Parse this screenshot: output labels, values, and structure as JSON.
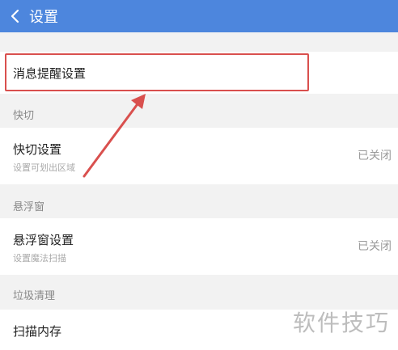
{
  "header": {
    "title": "设置",
    "back_icon": "chevron-left-icon"
  },
  "notification": {
    "label": "消息提醒设置"
  },
  "sections": {
    "quick_cut": "快切",
    "float_window": "悬浮窗",
    "junk_clean": "垃圾清理"
  },
  "quick_cut_setting": {
    "label": "快切设置",
    "sub": "设置可划出区域",
    "value": "已关闭"
  },
  "float_window_setting": {
    "label": "悬浮窗设置",
    "sub": "设置魔法扫描",
    "value": "已关闭"
  },
  "scan_memory": {
    "label": "扫描内存"
  },
  "watermark": "软件技巧",
  "colors": {
    "header": "#4d86dd",
    "highlight": "#d9504e"
  }
}
